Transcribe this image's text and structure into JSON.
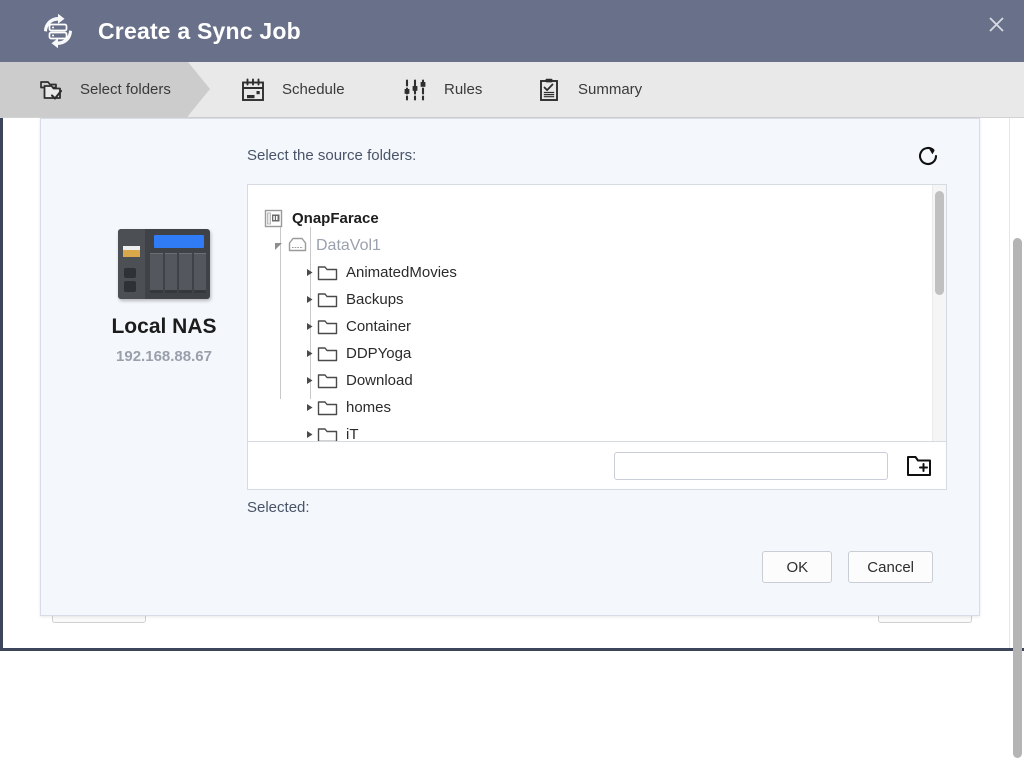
{
  "titlebar": {
    "title": "Create a Sync Job",
    "logo_icon": "sync-nas-icon",
    "close_icon": "close-icon"
  },
  "steps": [
    {
      "label": "Select folders",
      "icon": "folders-check-icon",
      "active": true
    },
    {
      "label": "Schedule",
      "icon": "calendar-icon",
      "active": false
    },
    {
      "label": "Rules",
      "icon": "sliders-icon",
      "active": false
    },
    {
      "label": "Summary",
      "icon": "clipboard-check-icon",
      "active": false
    }
  ],
  "nas_panel": {
    "icon": "nas-device-icon",
    "name": "Local NAS",
    "ip": "192.168.88.67"
  },
  "content": {
    "source_label": "Select the source folders:",
    "refresh_icon": "refresh-icon",
    "new_folder_input_value": "",
    "new_folder_input_placeholder": "",
    "new_folder_icon": "new-folder-icon",
    "selected_label": "Selected:",
    "selected_value": ""
  },
  "tree": [
    {
      "label": "QnapFarace",
      "level": 0,
      "kind": "root",
      "icon": "nas-server-icon",
      "twisty": "none"
    },
    {
      "label": "DataVol1",
      "level": 1,
      "kind": "vol",
      "icon": "volume-icon",
      "twisty": "expanded"
    },
    {
      "label": "AnimatedMovies",
      "level": 2,
      "kind": "folder",
      "icon": "folder-icon",
      "twisty": "collapsed"
    },
    {
      "label": "Backups",
      "level": 2,
      "kind": "folder",
      "icon": "folder-icon",
      "twisty": "collapsed"
    },
    {
      "label": "Container",
      "level": 2,
      "kind": "folder",
      "icon": "folder-icon",
      "twisty": "collapsed"
    },
    {
      "label": "DDPYoga",
      "level": 2,
      "kind": "folder",
      "icon": "folder-icon",
      "twisty": "collapsed"
    },
    {
      "label": "Download",
      "level": 2,
      "kind": "folder",
      "icon": "folder-icon",
      "twisty": "collapsed"
    },
    {
      "label": "homes",
      "level": 2,
      "kind": "folder",
      "icon": "folder-icon",
      "twisty": "collapsed"
    },
    {
      "label": "iT",
      "level": 2,
      "kind": "folder",
      "icon": "folder-icon",
      "twisty": "collapsed"
    }
  ],
  "footer": {
    "ok_label": "OK",
    "cancel_label": "Cancel"
  },
  "colors": {
    "titlebar": "#697089",
    "stepbar": "#e9e9e9",
    "step_active": "#cccccc",
    "dialog_bg": "#f4f7fc",
    "accent_blue": "#2f7cf6",
    "label_text": "#4a5468"
  }
}
